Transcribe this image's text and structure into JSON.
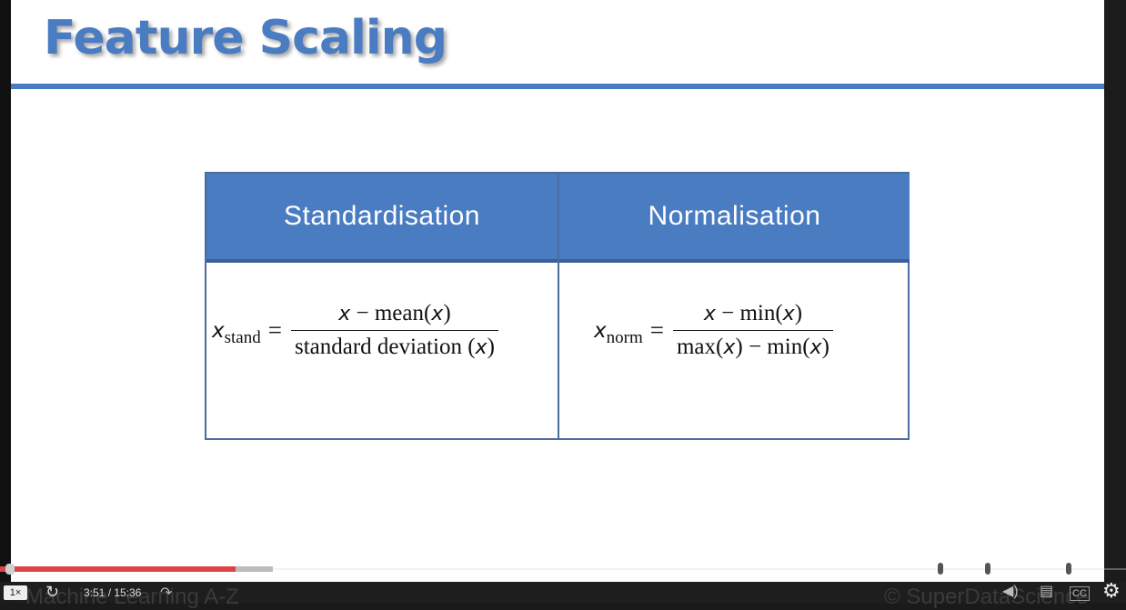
{
  "slide": {
    "title": "Feature Scaling",
    "table": {
      "headers": [
        "Standardisation",
        "Normalisation"
      ],
      "standardisation": {
        "lhs_var": "x",
        "lhs_sub": "stand",
        "equals": "=",
        "numerator_var": "x",
        "numerator_rest": " − mean(",
        "numerator_var2": "x",
        "numerator_close": ")",
        "denominator_text": "standard deviation (",
        "denominator_var": "x",
        "denominator_close": ")"
      },
      "normalisation": {
        "lhs_var": "x",
        "lhs_sub": "norm",
        "equals": "=",
        "numerator_var": "x",
        "numerator_rest": " − min(",
        "numerator_var2": "x",
        "numerator_close": ")",
        "den_a": "max(",
        "den_var1": "x",
        "den_b": ") − min(",
        "den_var2": "x",
        "den_c": ")"
      }
    },
    "footer_left": "Machine Learning A-Z",
    "footer_right": "© SuperDataScience"
  },
  "player": {
    "speed": "1×",
    "time": "3:51 / 15:36",
    "progress_fraction": 0.247,
    "progress_color": "#e0424a",
    "icons": [
      "replay-icon",
      "forward-icon",
      "volume-icon",
      "notes-icon",
      "captions-icon",
      "settings-icon"
    ]
  },
  "colors": {
    "accent": "#4a7cc1",
    "header_text": "#ffffff"
  }
}
